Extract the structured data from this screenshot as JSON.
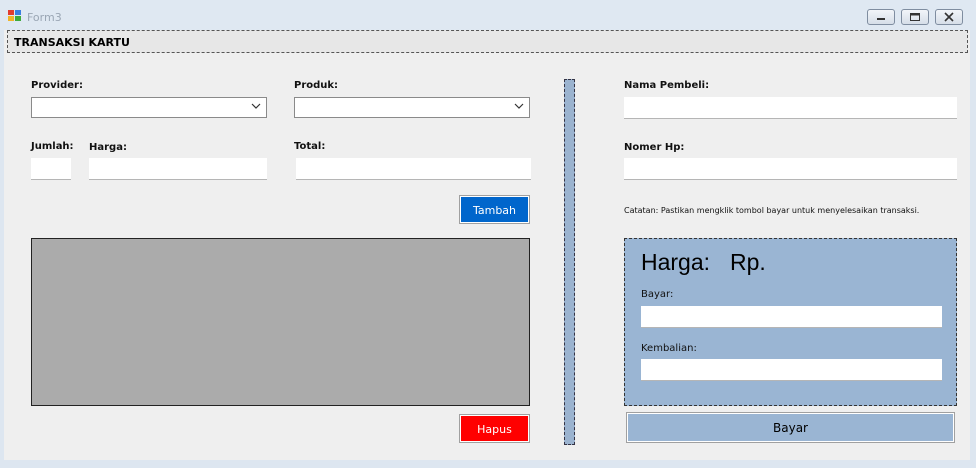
{
  "window": {
    "title": "Form3"
  },
  "header": {
    "title": "TRANSAKSI KARTU"
  },
  "form": {
    "provider_label": "Provider:",
    "produk_label": "Produk:",
    "jumlah_label": "Jumlah:",
    "harga_label": "Harga:",
    "total_label": "Total:",
    "tambah_label": "Tambah",
    "hapus_label": "Hapus"
  },
  "buyer": {
    "nama_label": "Nama Pembeli:",
    "nomer_label": "Nomer Hp:",
    "note": "Catatan: Pastikan mengklik tombol bayar untuk menyelesaikan transaksi."
  },
  "payment": {
    "harga_label": "Harga:",
    "currency": "Rp.",
    "bayar_label": "Bayar:",
    "kembalian_label": "Kembalian:",
    "bayar_button": "Bayar"
  },
  "colors": {
    "tambah_button": "#0066cc",
    "hapus_button": "#ff0000",
    "pay_panel": "#9ab5d3",
    "grid_bg": "#ababab"
  }
}
